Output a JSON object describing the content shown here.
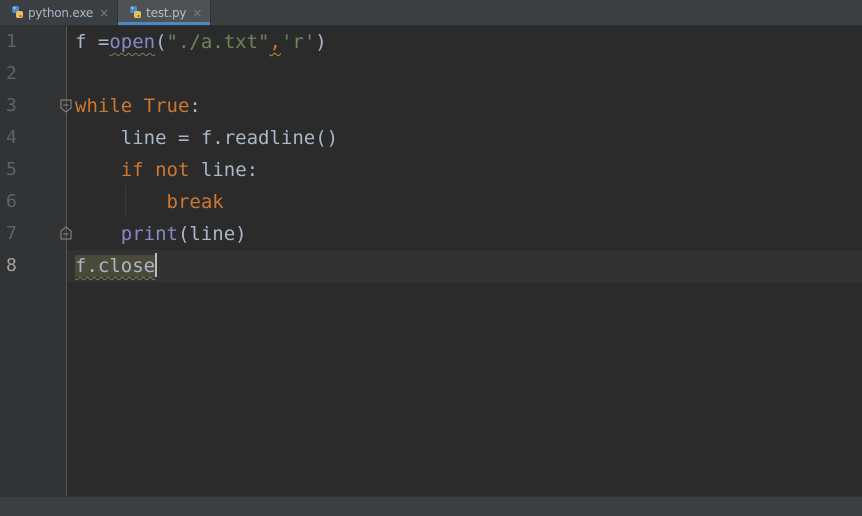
{
  "tabs": [
    {
      "label": "python.exe",
      "icon": "python-icon",
      "close": "×",
      "active": false
    },
    {
      "label": "test.py",
      "icon": "python-file-icon",
      "close": "×",
      "active": true
    }
  ],
  "editor": {
    "line_numbers": [
      "1",
      "2",
      "3",
      "4",
      "5",
      "6",
      "7",
      "8"
    ],
    "current_line": "8",
    "lines": [
      {
        "tokens": [
          "f =",
          "open",
          "(",
          "\"./a.txt\"",
          ",",
          "'r'",
          ")"
        ]
      },
      {
        "tokens": []
      },
      {
        "tokens": [
          "while",
          " ",
          "True",
          ":"
        ]
      },
      {
        "tokens": [
          "    line = f.readline()"
        ]
      },
      {
        "tokens": [
          "    ",
          "if",
          " ",
          "not",
          " line:"
        ]
      },
      {
        "tokens": [
          "        ",
          "break"
        ]
      },
      {
        "tokens": [
          "    ",
          "print",
          "(line)"
        ]
      },
      {
        "tokens": [
          "f.close"
        ]
      }
    ]
  },
  "colors": {
    "background": "#2b2b2b",
    "keyword": "#cc7832",
    "builtin": "#8888c6",
    "string": "#6a8759",
    "text": "#a9b7c6",
    "line_number": "#606366",
    "tab_accent": "#4a88c7"
  }
}
